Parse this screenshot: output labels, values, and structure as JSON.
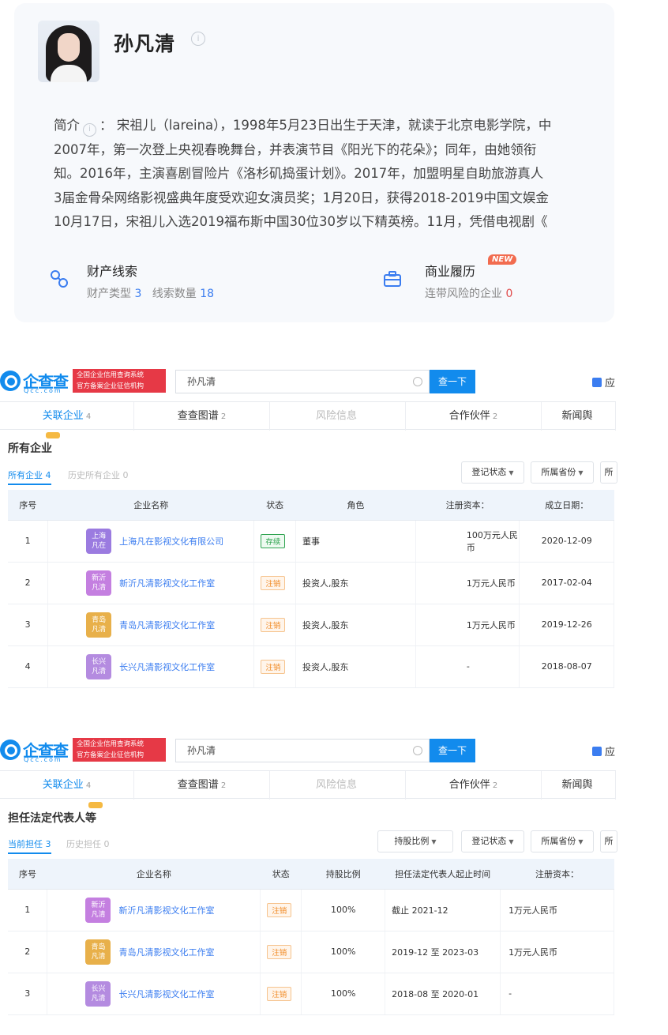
{
  "profile": {
    "name": "孙凡清",
    "bio_label": "简介",
    "bio_colon": "：",
    "bio_lines": [
      "宋祖儿（lareina），1998年5月23日出生于天津，就读于北京电影学院，中",
      "2007年，第一次登上央视春晚舞台，并表演节目《阳光下的花朵》；同年，由她领衔",
      "知。2016年，主演喜剧冒险片《洛杉矶捣蛋计划》。2017年，加盟明星自助旅游真人",
      "3届金骨朵网络影视盛典年度受欢迎女演员奖；1月20日，获得2018-2019中国文娱金",
      "10月17日，宋祖儿入选2019福布斯中国30位30岁以下精英榜。11月，凭借电视剧《"
    ],
    "features": [
      {
        "icon": "link-icon",
        "title": "财产线索",
        "sub1_label": "财产类型",
        "sub1_value": "3",
        "sub2_label": "线索数量",
        "sub2_value": "18"
      },
      {
        "icon": "briefcase-icon",
        "title": "商业履历",
        "badge": "NEW",
        "sub1_label": "连带风险的企业",
        "sub1_value": "0"
      }
    ]
  },
  "qcc1": {
    "logo_text": "企查查",
    "logo_sub": "Qcc.com",
    "logo_red_lines": [
      "全国企业信用查询系统",
      "官方备案企业征信机构"
    ],
    "search_value": "孙凡清",
    "search_button": "查一下",
    "topright": "应",
    "tabs": [
      {
        "label": "关联企业",
        "count": "4",
        "state": "active"
      },
      {
        "label": "查查图谱",
        "count": "2",
        "state": "normal"
      },
      {
        "label": "风险信息",
        "count": "",
        "state": "muted"
      },
      {
        "label": "合作伙伴",
        "count": "2",
        "state": "normal"
      },
      {
        "label": "新闻舆",
        "count": "",
        "state": "normal"
      }
    ],
    "section_title": "所有企业",
    "subtabs": [
      {
        "label": "所有企业 4",
        "state": "active"
      },
      {
        "label": "历史所有企业 0",
        "state": "inactive"
      }
    ],
    "filters": [
      "登记状态",
      "所属省份",
      "所"
    ],
    "columns": [
      "序号",
      "企业名称",
      "状态",
      "角色",
      "注册资本：",
      "成立日期："
    ],
    "rows": [
      {
        "no": "1",
        "logo": [
          "上海",
          "凡在"
        ],
        "logo_color": "#9b7be0",
        "name": "上海凡在影视文化有限公司",
        "status": "存续",
        "status_type": "ok",
        "role": "董事",
        "capital": "100万元人民币",
        "date": "2020-12-09"
      },
      {
        "no": "2",
        "logo": [
          "新沂",
          "凡清"
        ],
        "logo_color": "#c47fe0",
        "name": "新沂凡清影视文化工作室",
        "status": "注销",
        "status_type": "canc",
        "role": "投资人,股东",
        "capital": "1万元人民币",
        "date": "2017-02-04"
      },
      {
        "no": "3",
        "logo": [
          "青岛",
          "凡清"
        ],
        "logo_color": "#e8b04a",
        "name": "青岛凡清影视文化工作室",
        "status": "注销",
        "status_type": "canc",
        "role": "投资人,股东",
        "capital": "1万元人民币",
        "date": "2019-12-26"
      },
      {
        "no": "4",
        "logo": [
          "长兴",
          "凡清"
        ],
        "logo_color": "#b48be0",
        "name": "长兴凡清影视文化工作室",
        "status": "注销",
        "status_type": "canc",
        "role": "投资人,股东",
        "capital": "-",
        "date": "2018-08-07"
      }
    ]
  },
  "qcc2": {
    "logo_text": "企查查",
    "logo_sub": "Qcc.com",
    "logo_red_lines": [
      "全国企业信用查询系统",
      "官方备案企业征信机构"
    ],
    "search_value": "孙凡清",
    "search_button": "查一下",
    "topright": "应",
    "tabs": [
      {
        "label": "关联企业",
        "count": "4",
        "state": "active"
      },
      {
        "label": "查查图谱",
        "count": "2",
        "state": "normal"
      },
      {
        "label": "风险信息",
        "count": "",
        "state": "muted"
      },
      {
        "label": "合作伙伴",
        "count": "2",
        "state": "normal"
      },
      {
        "label": "新闻舆",
        "count": "",
        "state": "normal"
      }
    ],
    "section_title": "担任法定代表人等",
    "subtabs": [
      {
        "label": "当前担任 3",
        "state": "active"
      },
      {
        "label": "历史担任 0",
        "state": "inactive"
      }
    ],
    "filters": [
      "持股比例",
      "登记状态",
      "所属省份",
      "所"
    ],
    "columns": [
      "序号",
      "企业名称",
      "状态",
      "持股比例",
      "担任法定代表人起止时间",
      "注册资本："
    ],
    "rows": [
      {
        "no": "1",
        "logo": [
          "新沂",
          "凡清"
        ],
        "logo_color": "#c47fe0",
        "name": "新沂凡清影视文化工作室",
        "status": "注销",
        "status_type": "canc",
        "ratio": "100%",
        "period": "截止 2021-12",
        "capital": "1万元人民币"
      },
      {
        "no": "2",
        "logo": [
          "青岛",
          "凡清"
        ],
        "logo_color": "#e8b04a",
        "name": "青岛凡清影视文化工作室",
        "status": "注销",
        "status_type": "canc",
        "ratio": "100%",
        "period": "2019-12 至 2023-03",
        "capital": "1万元人民币"
      },
      {
        "no": "3",
        "logo": [
          "长兴",
          "凡清"
        ],
        "logo_color": "#b48be0",
        "name": "长兴凡清影视文化工作室",
        "status": "注销",
        "status_type": "canc",
        "ratio": "100%",
        "period": "2018-08 至 2020-01",
        "capital": "-"
      }
    ]
  }
}
